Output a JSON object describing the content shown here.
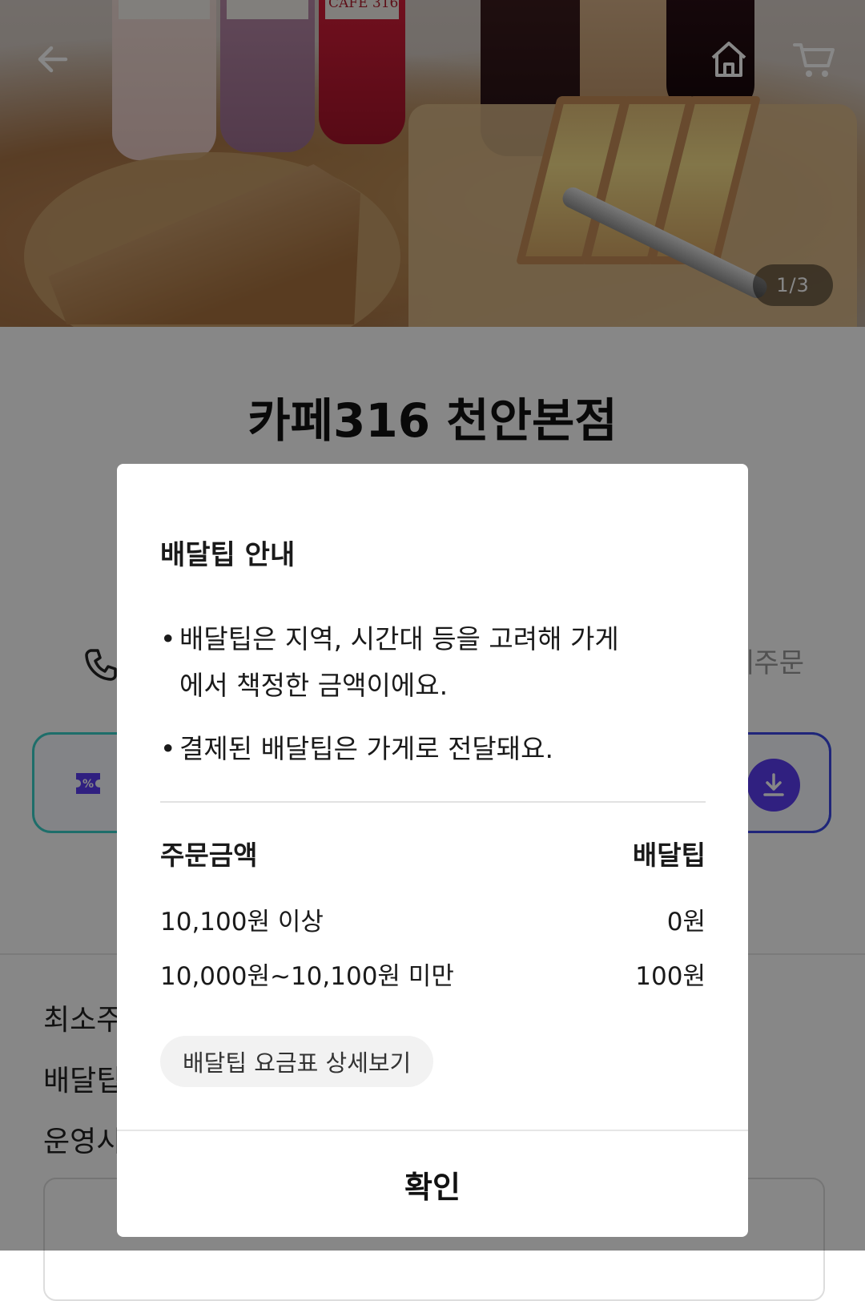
{
  "hero": {
    "image_counter": "1/3",
    "bottle_labels": [
      "CAFE 316"
    ]
  },
  "store": {
    "name": "카페316 천안본점",
    "group_order_label": "함께주문",
    "info_rows": [
      "최소주",
      "배달팁",
      "운영시"
    ]
  },
  "modal": {
    "title": "배달팁 안내",
    "bullets": [
      "배달팁은 지역, 시간대 등을 고려해 가게에서 책정한 금액이에요.",
      "결제된 배달팁은 가게로 전달돼요."
    ],
    "table": {
      "header": {
        "amount": "주문금액",
        "tip": "배달팁"
      },
      "rows": [
        {
          "amount": "10,100원 이상",
          "tip": "0원"
        },
        {
          "amount": "10,000원~10,100원 미만",
          "tip": "100원"
        }
      ]
    },
    "detail_button": "배달팁 요금표 상세보기",
    "confirm_button": "확인"
  },
  "colors": {
    "overlay": "#000000",
    "coupon_border_left": "#3ad0c8",
    "coupon_border_right": "#3d47e6",
    "download_button": "#5b3ef2",
    "coupon_icon": "#5b3ef2"
  },
  "icons": {
    "back": "arrow-left-icon",
    "home": "home-icon",
    "cart": "cart-icon",
    "phone": "phone-icon",
    "coupon": "coupon-icon",
    "download": "download-icon"
  }
}
